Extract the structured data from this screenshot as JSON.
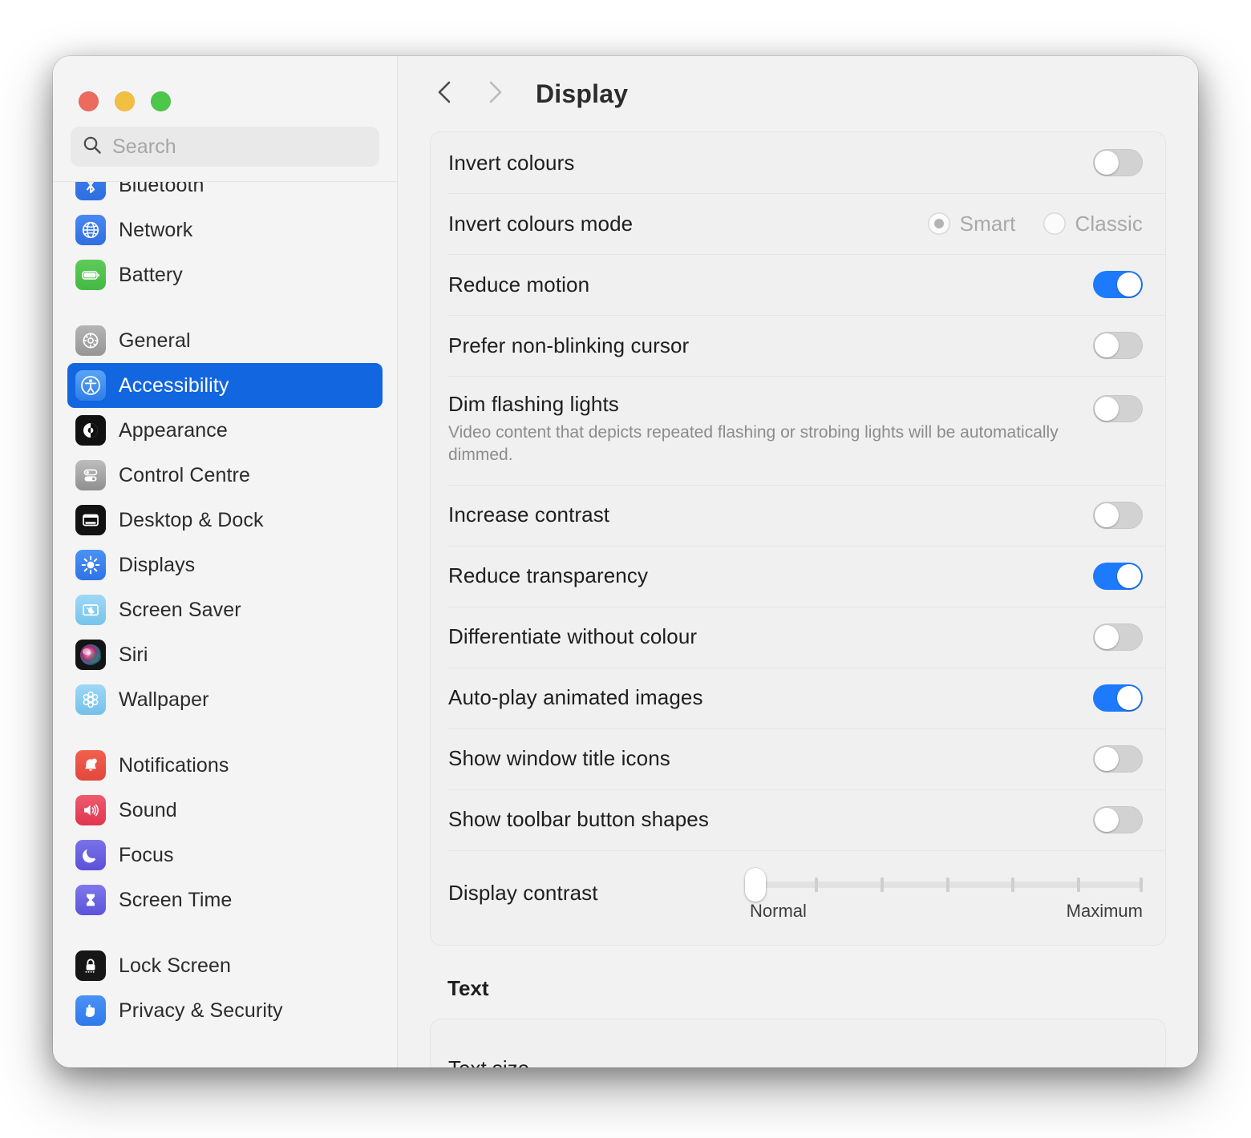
{
  "window": {
    "traffic_lights": [
      {
        "name": "close",
        "color": "#ec6a5e"
      },
      {
        "name": "minimize",
        "color": "#f1bf42"
      },
      {
        "name": "zoom",
        "color": "#4cc749"
      }
    ]
  },
  "sidebar": {
    "search": {
      "placeholder": "Search",
      "value": "",
      "icon": "search-icon"
    },
    "groups": [
      {
        "items": [
          {
            "label": "Bluetooth",
            "icon": "bluetooth-icon",
            "selected": false
          },
          {
            "label": "Network",
            "icon": "globe-icon",
            "selected": false
          },
          {
            "label": "Battery",
            "icon": "battery-icon",
            "selected": false
          }
        ]
      },
      {
        "items": [
          {
            "label": "General",
            "icon": "gear-icon",
            "selected": false
          },
          {
            "label": "Accessibility",
            "icon": "accessibility-icon",
            "selected": true
          },
          {
            "label": "Appearance",
            "icon": "appearance-icon",
            "selected": false
          },
          {
            "label": "Control Centre",
            "icon": "control-centre-icon",
            "selected": false
          },
          {
            "label": "Desktop & Dock",
            "icon": "desktop-dock-icon",
            "selected": false
          },
          {
            "label": "Displays",
            "icon": "brightness-icon",
            "selected": false
          },
          {
            "label": "Screen Saver",
            "icon": "screen-saver-icon",
            "selected": false
          },
          {
            "label": "Siri",
            "icon": "siri-icon",
            "selected": false
          },
          {
            "label": "Wallpaper",
            "icon": "wallpaper-icon",
            "selected": false
          }
        ]
      },
      {
        "items": [
          {
            "label": "Notifications",
            "icon": "bell-icon",
            "selected": false
          },
          {
            "label": "Sound",
            "icon": "speaker-icon",
            "selected": false
          },
          {
            "label": "Focus",
            "icon": "moon-icon",
            "selected": false
          },
          {
            "label": "Screen Time",
            "icon": "hourglass-icon",
            "selected": false
          }
        ]
      },
      {
        "items": [
          {
            "label": "Lock Screen",
            "icon": "lock-icon",
            "selected": false
          },
          {
            "label": "Privacy & Security",
            "icon": "hand-icon",
            "selected": false
          }
        ]
      }
    ]
  },
  "toolbar": {
    "back_icon": "chevron-left-icon",
    "forward_icon": "chevron-right-icon",
    "title": "Display"
  },
  "display_section": {
    "rows": [
      {
        "label": "Invert colours",
        "control": "toggle",
        "value": "off"
      },
      {
        "label": "Invert colours mode",
        "control": "radio-group",
        "disabled": true,
        "options": [
          {
            "label": "Smart",
            "selected": true
          },
          {
            "label": "Classic",
            "selected": false
          }
        ]
      },
      {
        "label": "Reduce motion",
        "control": "toggle",
        "value": "on"
      },
      {
        "label": "Prefer non-blinking cursor",
        "control": "toggle",
        "value": "off"
      },
      {
        "label": "Dim flashing lights",
        "control": "toggle",
        "value": "off",
        "description": "Video content that depicts repeated flashing or strobing lights will be automatically dimmed."
      },
      {
        "label": "Increase contrast",
        "control": "toggle",
        "value": "off"
      },
      {
        "label": "Reduce transparency",
        "control": "toggle",
        "value": "on"
      },
      {
        "label": "Differentiate without colour",
        "control": "toggle",
        "value": "off"
      },
      {
        "label": "Auto-play animated images",
        "control": "toggle",
        "value": "on"
      },
      {
        "label": "Show window title icons",
        "control": "toggle",
        "value": "off"
      },
      {
        "label": "Show toolbar button shapes",
        "control": "toggle",
        "value": "off"
      },
      {
        "label": "Display contrast",
        "control": "slider",
        "min_label": "Normal",
        "max_label": "Maximum",
        "position_percent": 0,
        "tick_count": 6
      }
    ]
  },
  "text_section": {
    "title": "Text",
    "rows": [
      {
        "label": "Text size"
      }
    ]
  },
  "colors": {
    "accent": "#1d7afc",
    "selection": "#1266e0",
    "window_bg": "#f2f2f2",
    "sidebar_bg": "#f4f4f4",
    "card_bg": "#f0f0f0"
  }
}
